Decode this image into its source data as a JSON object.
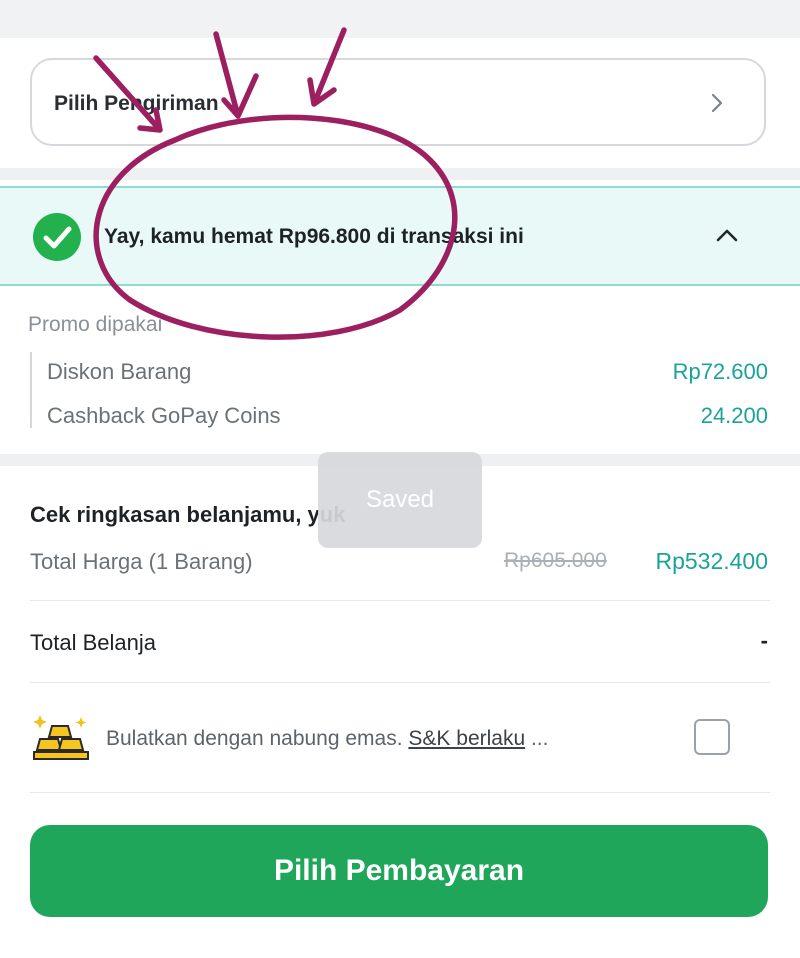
{
  "shipping": {
    "label": "Pilih Pengiriman"
  },
  "promo_banner": {
    "text": "Yay, kamu hemat Rp96.800 di transaksi ini"
  },
  "promo": {
    "used_label": "Promo dipakai",
    "items": [
      {
        "label": "Diskon Barang",
        "value": "Rp72.600"
      },
      {
        "label": "Cashback GoPay Coins",
        "value": "24.200"
      }
    ]
  },
  "summary": {
    "title": "Cek ringkasan belanjamu, yuk",
    "total_price_label": "Total Harga (1 Barang)",
    "original_price": "Rp605.000",
    "total_price": "Rp532.400",
    "total_belanja_label": "Total Belanja",
    "total_belanja_value": "-"
  },
  "gold": {
    "text": "Bulatkan dengan nabung emas. ",
    "link": "S&K berlaku",
    "ellipsis": " ..."
  },
  "pay_button": {
    "label": "Pilih Pembayaran"
  },
  "toast": {
    "text": "Saved"
  },
  "colors": {
    "accent_green": "#1fa65a",
    "teal_value": "#1aa39a",
    "annotation": "#9c2060"
  },
  "icons": {
    "shipping_chevron": "chevron-right-icon",
    "promo_check": "check-circle-icon",
    "promo_chevron": "chevron-up-icon",
    "gold": "gold-bars-icon"
  }
}
